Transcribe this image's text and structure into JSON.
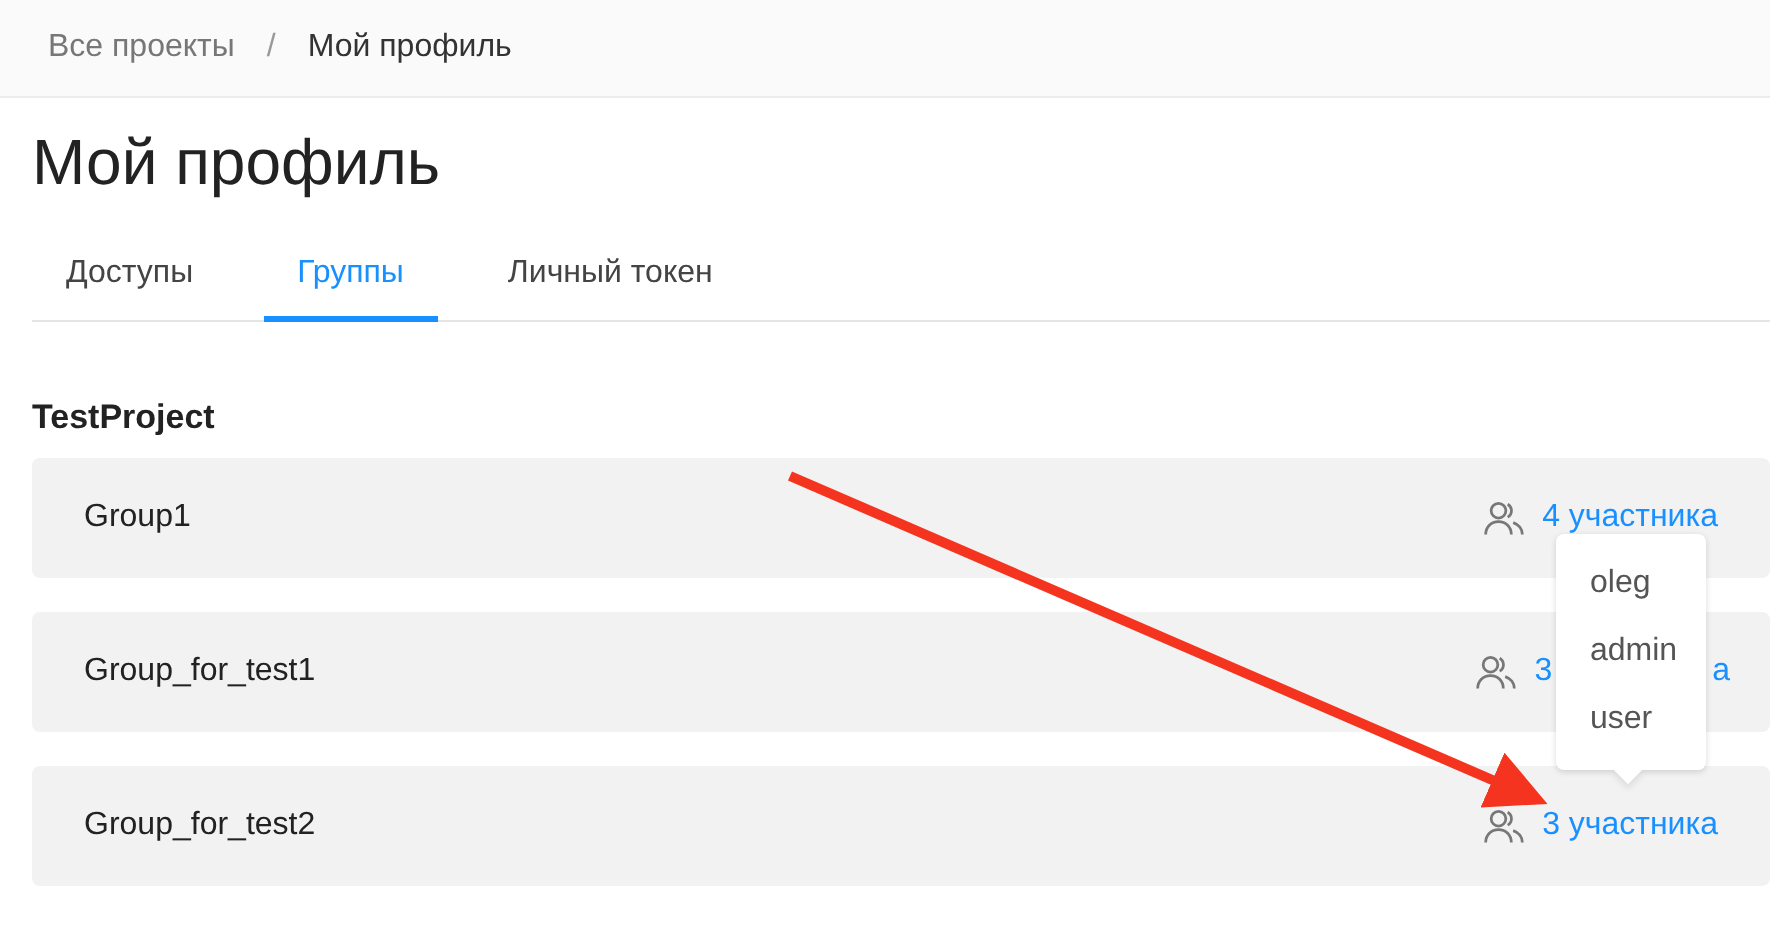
{
  "breadcrumbs": [
    {
      "label": "Все проекты",
      "current": false
    },
    {
      "label": "Мой профиль",
      "current": true
    }
  ],
  "breadcrumb_separator": "/",
  "title": "Мой профиль",
  "tabs": [
    {
      "label": "Доступы",
      "selected": false
    },
    {
      "label": "Группы",
      "selected": true
    },
    {
      "label": "Личный токен",
      "selected": false
    }
  ],
  "project": "TestProject",
  "groups": [
    {
      "name": "Group1",
      "members": "4 участника"
    },
    {
      "name": "Group_for_test1",
      "members": "3",
      "members_end": "а"
    },
    {
      "name": "Group_for_test2",
      "members": "3 участника",
      "popup": [
        "oleg",
        "admin",
        "user"
      ]
    }
  ]
}
